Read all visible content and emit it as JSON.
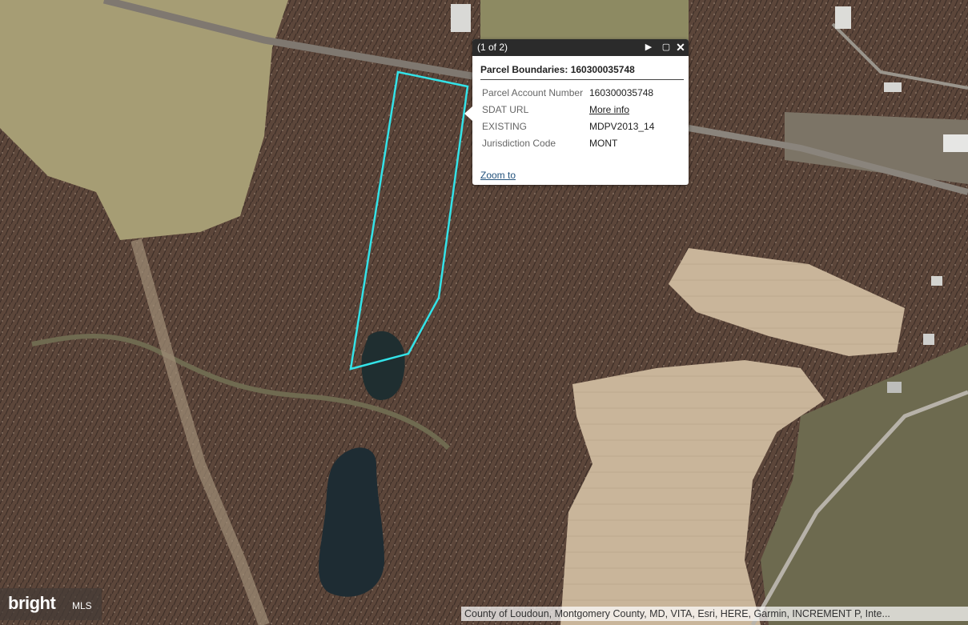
{
  "popup": {
    "count": "(1 of 2)",
    "title": "Parcel Boundaries: 160300035748",
    "attributes": [
      {
        "key": "Parcel Account Number",
        "value": "160300035748"
      },
      {
        "key": "SDAT URL",
        "value": "More info"
      },
      {
        "key": "EXISTING",
        "value": "MDPV2013_14"
      },
      {
        "key": "Jurisdiction Code",
        "value": "MONT"
      }
    ],
    "zoom_label": "Zoom to",
    "icons": [
      "play-icon",
      "maximize-icon",
      "close-icon"
    ]
  },
  "attribution": "County of Loudoun, Montgomery County, MD, VITA, Esri, HERE, Garmin, INCREMENT P, Inte...",
  "watermark": {
    "brand": "bright",
    "suffix": "MLS"
  },
  "colors": {
    "parcel_outline": "#33e3e8",
    "popup_header": "#2b2b2b",
    "link": "#23527c"
  }
}
